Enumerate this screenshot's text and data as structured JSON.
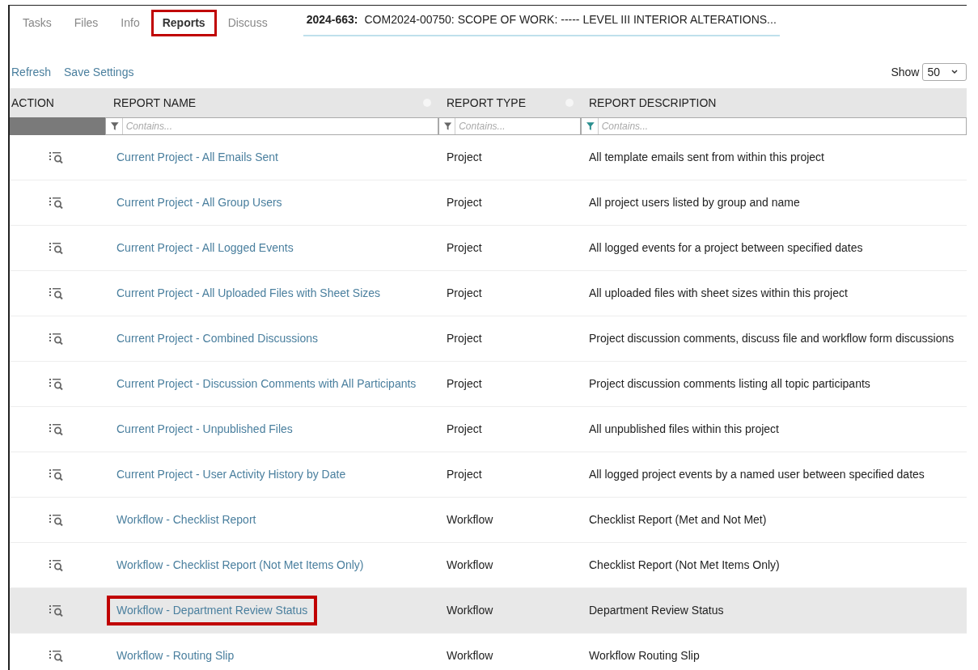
{
  "tabs": [
    {
      "label": "Tasks",
      "selected": false,
      "highlighted": false
    },
    {
      "label": "Files",
      "selected": false,
      "highlighted": false
    },
    {
      "label": "Info",
      "selected": false,
      "highlighted": false
    },
    {
      "label": "Reports",
      "selected": true,
      "highlighted": true
    },
    {
      "label": "Discuss",
      "selected": false,
      "highlighted": false
    }
  ],
  "project_title": {
    "code": "2024-663:",
    "text": "COM2024-00750: SCOPE OF WORK: ----- LEVEL III INTERIOR ALTERATIONS..."
  },
  "toolbar": {
    "links": [
      "Refresh",
      "Save Settings"
    ],
    "show_label": "Show",
    "page_size": "50"
  },
  "table": {
    "columns": [
      {
        "label": "ACTION",
        "settings": false
      },
      {
        "label": "REPORT NAME",
        "settings": true,
        "filter": {
          "placeholder": "Contains...",
          "active": false
        }
      },
      {
        "label": "REPORT TYPE",
        "settings": true,
        "filter": {
          "placeholder": "Contains...",
          "active": false
        }
      },
      {
        "label": "REPORT DESCRIPTION",
        "settings": false,
        "filter": {
          "placeholder": "Contains...",
          "active": true
        }
      }
    ],
    "rows": [
      {
        "name": "Current Project - All Emails Sent",
        "type": "Project",
        "description": "All template emails sent from within this project",
        "selected": false,
        "highlighted": false
      },
      {
        "name": "Current Project - All Group Users",
        "type": "Project",
        "description": "All project users listed by group and name",
        "selected": false,
        "highlighted": false
      },
      {
        "name": "Current Project - All Logged Events",
        "type": "Project",
        "description": "All logged events for a project between specified dates",
        "selected": false,
        "highlighted": false
      },
      {
        "name": "Current Project - All Uploaded Files with Sheet Sizes",
        "type": "Project",
        "description": "All uploaded files with sheet sizes within this project",
        "selected": false,
        "highlighted": false
      },
      {
        "name": "Current Project - Combined Discussions",
        "type": "Project",
        "description": "Project discussion comments, discuss file and workflow form discussions",
        "selected": false,
        "highlighted": false
      },
      {
        "name": "Current Project - Discussion Comments with All Participants",
        "type": "Project",
        "description": "Project discussion comments listing all topic participants",
        "selected": false,
        "highlighted": false
      },
      {
        "name": "Current Project - Unpublished Files",
        "type": "Project",
        "description": "All unpublished files within this project",
        "selected": false,
        "highlighted": false
      },
      {
        "name": "Current Project - User Activity History by Date",
        "type": "Project",
        "description": "All logged project events by a named user between specified dates",
        "selected": false,
        "highlighted": false
      },
      {
        "name": "Workflow - Checklist Report",
        "type": "Workflow",
        "description": "Checklist Report (Met and Not Met)",
        "selected": false,
        "highlighted": false
      },
      {
        "name": "Workflow - Checklist Report (Not Met Items Only)",
        "type": "Workflow",
        "description": "Checklist Report (Not Met Items Only)",
        "selected": false,
        "highlighted": false
      },
      {
        "name": "Workflow - Department Review Status",
        "type": "Workflow",
        "description": "Department Review Status",
        "selected": true,
        "highlighted": true
      },
      {
        "name": "Workflow - Routing Slip",
        "type": "Workflow",
        "description": "Workflow Routing Slip",
        "selected": false,
        "highlighted": false
      }
    ]
  }
}
